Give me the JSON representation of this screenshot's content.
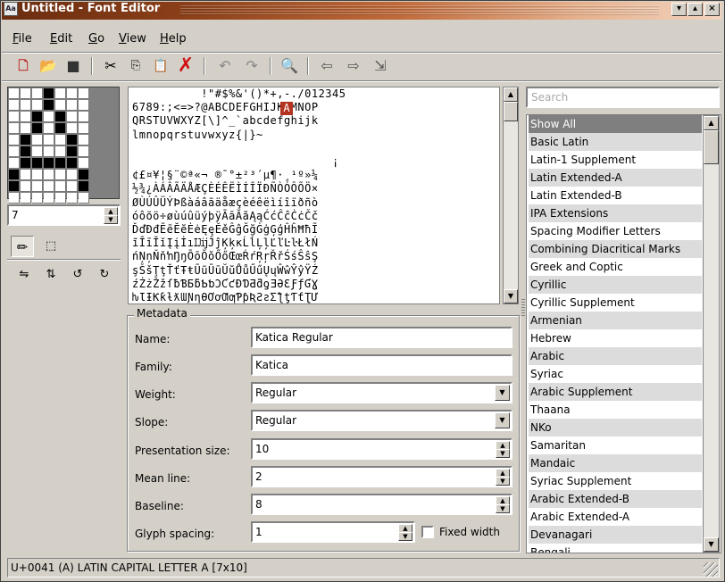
{
  "window": {
    "title": "Untitled - Font Editor",
    "controls": {
      "minimize": "▾",
      "maximize": "▴",
      "close": "×"
    }
  },
  "menu": [
    "File",
    "Edit",
    "Go",
    "View",
    "Help"
  ],
  "toolbar": {
    "icons": [
      "new-font-icon",
      "open-icon",
      "save-icon",
      "cut-icon",
      "copy-icon",
      "paste-icon",
      "delete-icon",
      "undo-icon",
      "redo-icon",
      "find-icon",
      "previous-icon",
      "next-icon",
      "go-to-icon"
    ]
  },
  "glyph_editor": {
    "glyph": "A",
    "grid": {
      "cols": 7,
      "rows": 10
    },
    "pixels": [
      "0001000",
      "0001000",
      "0010100",
      "0010100",
      "0100010",
      "0100010",
      "0111110",
      "1000001",
      "1000001",
      "0000000"
    ]
  },
  "size_field": {
    "value": "7"
  },
  "charmap": {
    "lines": [
      "          !\"#$%&'()*+,-./012345",
      "6789:;<=>?@ABCDEFGHIJKLMNOP",
      "QRSTUVWXYZ[\\]^_`abcdefghijk",
      "lmnopqrstuvwxyz{|}~",
      "",
      "                             ¡",
      "¢£¤¥¦§¨©ª«¬ ®¯°±²³´µ¶·¸¹º»¼",
      "½¾¿ÀÁÂÃÄÅÆÇÈÉÊËÌÍÎÏÐÑÒÓÔÕÖ×",
      "ØÙÚÛÜÝÞßàáâãäåæçèéêëìíîïðñò",
      "óôõö÷øùúûüýþÿĀāĂăĄąĆćĈĉĊċČč",
      "ĎďĐđĒēĔĕĖėĘęĚěĜĝĞğĠġĢģĤĥĦħĨ",
      "ĩĪīĬĭĮįİıĲĳĴĵĶķĸĹĺĻļĽľĿŀŁłŃ",
      "ńŅņŇňŉŊŋŌōŎŏŐőŒœŔŕŖŗŘřŚśŜŝŞ",
      "şŠšŢţŤťŦŧŨũŪūŬŭŮůŰűŲųŴŵŶŷŸŹ",
      "źŻżŽžſƀƁƂƃƄƅƆƇƈƉƊƋƌƍƎƏƐƑƒƓƔ",
      "ƕƖƗƘƙƚƛƜƝƞƟƠơƢƣƤƥƦƧƨƩƪƫƬƭƮƯ",
      "ưƱƲƳƴƵƶƷƸƹƺƻƼƽƾƿǀǁǂǃǄǅǆǇǈǉǊ"
    ],
    "selected_char": "A"
  },
  "metadata": {
    "legend": "Metadata",
    "fields": [
      {
        "label": "Name:",
        "value": "Katica Regular",
        "kind": "text"
      },
      {
        "label": "Family:",
        "value": "Katica",
        "kind": "text"
      },
      {
        "label": "Weight:",
        "value": "Regular",
        "kind": "dropdown"
      },
      {
        "label": "Slope:",
        "value": "Regular",
        "kind": "dropdown"
      },
      {
        "label": "Presentation size:",
        "value": "10",
        "kind": "spin"
      },
      {
        "label": "Mean line:",
        "value": "2",
        "kind": "spin"
      },
      {
        "label": "Baseline:",
        "value": "8",
        "kind": "spin"
      },
      {
        "label": "Glyph spacing:",
        "value": "1",
        "kind": "spin"
      }
    ],
    "fixed_width": {
      "label": "Fixed width",
      "checked": false
    }
  },
  "search": {
    "placeholder": "Search"
  },
  "blocks": {
    "items": [
      "Show All",
      "Basic Latin",
      "Latin-1 Supplement",
      "Latin Extended-A",
      "Latin Extended-B",
      "IPA Extensions",
      "Spacing Modifier Letters",
      "Combining Diacritical Marks",
      "Greek and Coptic",
      "Cyrillic",
      "Cyrillic Supplement",
      "Armenian",
      "Hebrew",
      "Arabic",
      "Syriac",
      "Arabic Supplement",
      "Thaana",
      "NKo",
      "Samaritan",
      "Mandaic",
      "Syriac Supplement",
      "Arabic Extended-B",
      "Arabic Extended-A",
      "Devanagari",
      "Bengali"
    ],
    "selected_index": 0
  },
  "status": {
    "text": "U+0041 (A) LATIN CAPITAL LETTER A [7x10]"
  }
}
